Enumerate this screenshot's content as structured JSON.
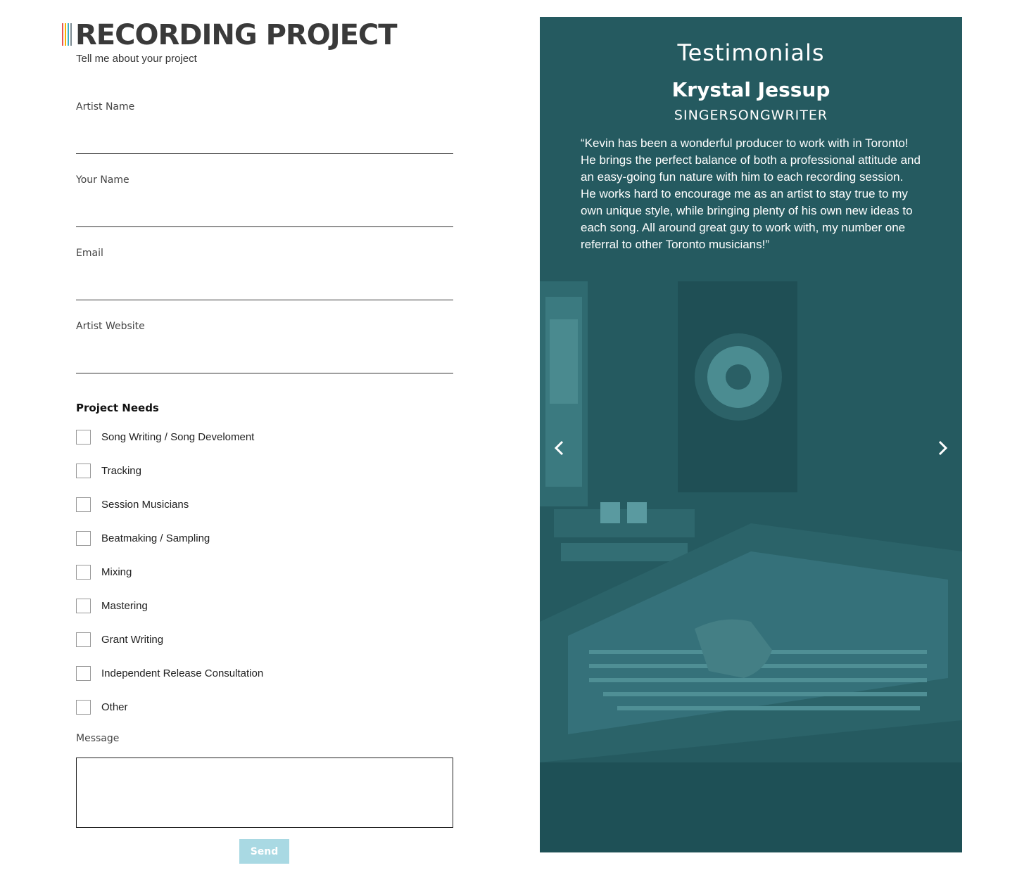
{
  "header": {
    "title": "RECORDING PROJECT",
    "subtitle": "Tell me about your project",
    "bar_colors": [
      "#e8554e",
      "#f5b400",
      "#3ab0c6",
      "#7d8c93"
    ]
  },
  "form": {
    "fields": [
      {
        "label": "Artist Name",
        "value": ""
      },
      {
        "label": "Your Name",
        "value": ""
      },
      {
        "label": "Email",
        "value": ""
      },
      {
        "label": "Artist Website",
        "value": ""
      }
    ],
    "needs_heading": "Project Needs",
    "needs": [
      {
        "label": "Song Writing / Song Develoment",
        "checked": false
      },
      {
        "label": "Tracking",
        "checked": false
      },
      {
        "label": "Session Musicians",
        "checked": false
      },
      {
        "label": "Beatmaking / Sampling",
        "checked": false
      },
      {
        "label": "Mixing",
        "checked": false
      },
      {
        "label": "Mastering",
        "checked": false
      },
      {
        "label": "Grant Writing",
        "checked": false
      },
      {
        "label": "Independent Release Consultation",
        "checked": false
      },
      {
        "label": "Other",
        "checked": false
      }
    ],
    "message_label": "Message",
    "message_value": "",
    "send_label": "Send",
    "send_color": "#a9d9e3"
  },
  "testimonials": {
    "heading": "Testimonials",
    "name": "Krystal Jessup",
    "role": "SINGERSONGWRITER",
    "quote": "“Kevin has been a wonderful producer to work with in Toronto! He brings the perfect balance of both a professional attitude and an easy-going fun nature with him to each recording session. He works hard to encourage me as an artist to stay true to my own unique style, while bringing plenty of his own new ideas to each song. All around great guy to work with, my number one referral to other Toronto musicians!”",
    "overlay_color": "#255a60",
    "prev_icon": "chevron-left-icon",
    "next_icon": "chevron-right-icon"
  }
}
